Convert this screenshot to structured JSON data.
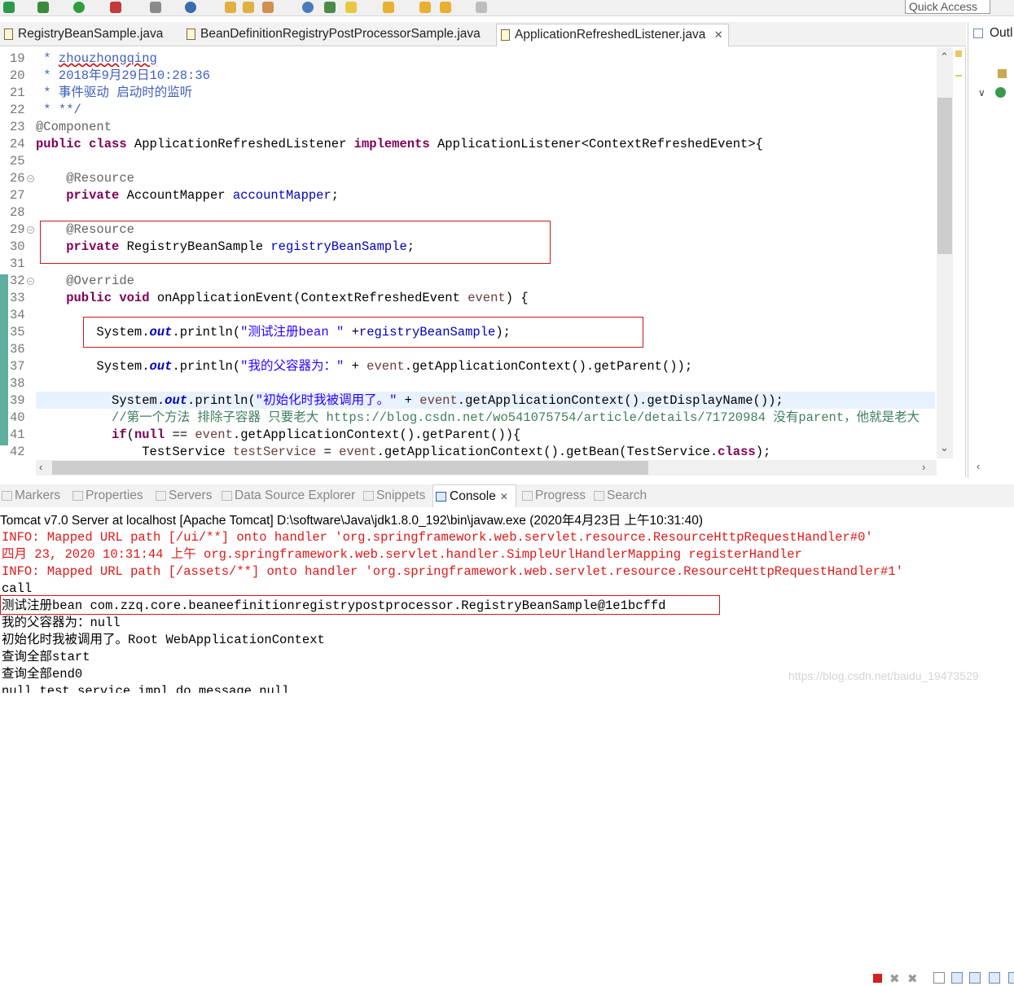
{
  "toolbar": {
    "quick_access_placeholder": "Quick Access"
  },
  "editor_tabs": [
    {
      "label": "RegistryBeanSample.java"
    },
    {
      "label": "BeanDefinitionRegistryPostProcessorSample.java"
    },
    {
      "label": "ApplicationRefreshedListener.java",
      "close": "✕"
    }
  ],
  "outline": {
    "title": "Outl"
  },
  "code": {
    "line_numbers": [
      "19",
      "20",
      "21",
      "22",
      "23",
      "24",
      "25",
      "26",
      "27",
      "28",
      "29",
      "30",
      "31",
      "32",
      "33",
      "34",
      "35",
      "36",
      "37",
      "38",
      "39",
      "40",
      "41",
      "42"
    ],
    "l19a": " * ",
    "l19b": "zhouzhongqing",
    "l20": " * 2018年9月29日10:28:36",
    "l21": " * 事件驱动 启动时的监听",
    "l22": " * **/",
    "l23": "@Component",
    "l24_kw1": "public class",
    "l24_t1": " ApplicationRefreshedListener ",
    "l24_kw2": "implements",
    "l24_t2": " ApplicationListener<ContextRefreshedEvent>{",
    "l26": "    @Resource",
    "l27_kw": "    private",
    "l27_t": " AccountMapper ",
    "l27_f": "accountMapper",
    "l27_e": ";",
    "l29": "    @Resource",
    "l30_kw": "    private",
    "l30_t": " RegistryBeanSample ",
    "l30_f": "registryBeanSample",
    "l30_e": ";",
    "l32": "    @Override",
    "l33_kw": "    public void",
    "l33_t": " onApplicationEvent(ContextRefreshedEvent ",
    "l33_p": "event",
    "l33_e": ") {",
    "l35_a": "        System.",
    "l35_sf": "out",
    "l35_b": ".println(",
    "l35_s": "\"测试注册bean \"",
    "l35_c": " +",
    "l35_f": "registryBeanSample",
    "l35_d": ");",
    "l37_a": "        System.",
    "l37_sf": "out",
    "l37_b": ".println(",
    "l37_s": "\"我的父容器为：\"",
    "l37_c": " + ",
    "l37_p": "event",
    "l37_d": ".getApplicationContext().getParent());",
    "l39_a": "          System.",
    "l39_sf": "out",
    "l39_b": ".println(",
    "l39_s": "\"初始化时我被调用了。\"",
    "l39_c": " + ",
    "l39_p": "event",
    "l39_d": ".getApplicationContext().getDisplayName());",
    "l40": "          //第一个方法 排除子容器 只要老大 https://blog.csdn.net/wo541075754/article/details/71720984 没有parent，他就是老大",
    "l41_a": "          ",
    "l41_kw": "if",
    "l41_b": "(",
    "l41_kw2": "null",
    "l41_c": " == ",
    "l41_p": "event",
    "l41_d": ".getApplicationContext().getParent()){",
    "l42_a": "              TestService ",
    "l42_v": "testService",
    "l42_b": " = ",
    "l42_p": "event",
    "l42_c": ".getApplicationContext().getBean(TestService.",
    "l42_kw": "class",
    "l42_d": ");"
  },
  "bottom_tabs": [
    "Markers",
    "Properties",
    "Servers",
    "Data Source Explorer",
    "Snippets",
    "Console",
    "Progress",
    "Search"
  ],
  "console_close": "✕",
  "console": {
    "description": "Tomcat v7.0 Server at localhost [Apache Tomcat] D:\\software\\Java\\jdk1.8.0_192\\bin\\javaw.exe (2020年4月23日 上午10:31:40)",
    "lines": [
      "INFO: Mapped URL path [/ui/**] onto handler 'org.springframework.web.servlet.resource.ResourceHttpRequestHandler#0'",
      "四月 23, 2020 10:31:44 上午 org.springframework.web.servlet.handler.SimpleUrlHandlerMapping registerHandler",
      "INFO: Mapped URL path [/assets/**] onto handler 'org.springframework.web.servlet.resource.ResourceHttpRequestHandler#1'",
      "call",
      "测试注册bean com.zzq.core.beaneefinitionregistrypostprocessor.RegistryBeanSample@1e1bcffd",
      "我的父容器为：null",
      "初始化时我被调用了。Root WebApplicationContext",
      "查询全部start",
      "查询全部end0",
      "null test service impl do message null"
    ]
  },
  "watermark": "https://blog.csdn.net/baidu_19473529"
}
